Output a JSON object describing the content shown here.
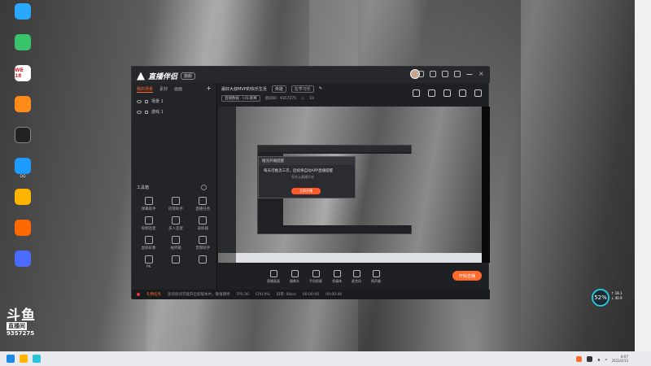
{
  "desktop": {
    "icons": [
      {
        "label": "",
        "color": "#2aa8ff"
      },
      {
        "label": "",
        "color": "#39c36b"
      },
      {
        "label": "WE 18",
        "color": "#d22"
      },
      {
        "label": "",
        "color": "#ff8c1a"
      },
      {
        "label": "",
        "color": "#222"
      },
      {
        "label": "QQ",
        "color": "#1e9bff"
      },
      {
        "label": "",
        "color": "#ffb400"
      },
      {
        "label": "",
        "color": "#ff6a00"
      },
      {
        "label": "",
        "color": "#4b6bff"
      }
    ]
  },
  "app": {
    "brand": "直播伴侣",
    "version": "旗舰",
    "scene_tabs": [
      "我的场景",
      "素材",
      "画面"
    ],
    "scenes": [
      "场景 1",
      "游戏 1"
    ],
    "stream_title": "最好大叔MVP的快乐生活",
    "tags": [
      "英雄",
      "在学习乐"
    ],
    "sub_info": [
      "直播数据 · LOL联赛",
      "房间ID：9357275",
      "33"
    ],
    "tools_header": "工具箱",
    "tools": [
      "弹幕助手",
      "房管助手",
      "直播任务",
      "视频连麦",
      "多人连麦",
      "录屏器",
      "虚拟形象",
      "抽奖箱",
      "音频助手",
      "PK",
      "",
      ""
    ],
    "dialog": {
      "title": "推流开播提醒",
      "message": "每天可推流三次，后续将自动APP直播提醒",
      "sub": "您在认真播开启",
      "button": "立即开播"
    },
    "controls": [
      "直播画面",
      "摄像头",
      "手机投屏",
      "多媒体",
      "麦克风",
      "扬声器"
    ],
    "start_button": "开始直播",
    "status": {
      "warning": "礼物任务",
      "notice": "您的房间可能开启新版本中，敬请期待",
      "fps": "FPS:30",
      "cpu": "CPU:0%",
      "bitrate": "码率: 0kb/s",
      "time1": "00:00:00",
      "time2": "00:00:00"
    }
  },
  "watermark": {
    "logo": "斗鱼",
    "sub": "直播间",
    "room": "9357275"
  },
  "gauge": {
    "value": "52%",
    "up": "18.1",
    "down": "40.9"
  },
  "taskbar": {
    "time": "8:07",
    "date": "2022/2/12"
  }
}
